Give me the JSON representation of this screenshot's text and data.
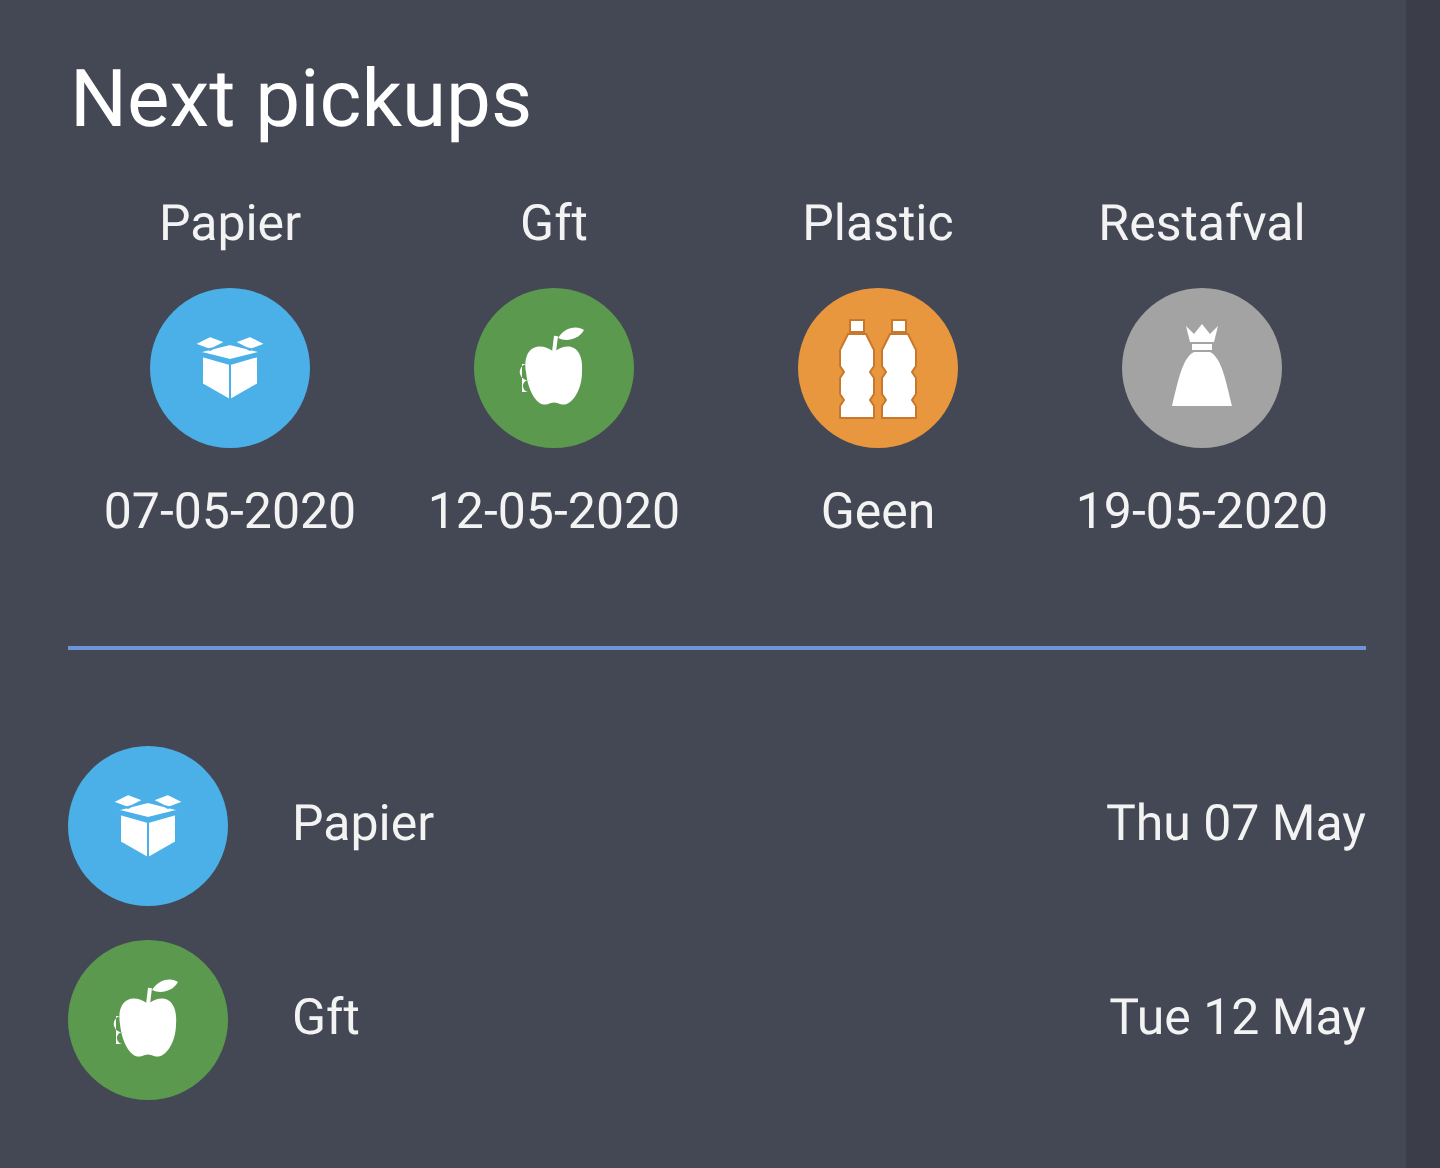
{
  "title": "Next pickups",
  "summary": [
    {
      "kind": "paper",
      "label": "Papier",
      "color": "#4bb0e8",
      "date": "07-05-2020"
    },
    {
      "kind": "organic",
      "label": "Gft",
      "color": "#5b9a4e",
      "date": "12-05-2020"
    },
    {
      "kind": "plastic",
      "label": "Plastic",
      "color": "#e8973e",
      "date": "Geen"
    },
    {
      "kind": "residual",
      "label": "Restafval",
      "color": "#a3a3a3",
      "date": "19-05-2020"
    }
  ],
  "list": [
    {
      "kind": "paper",
      "label": "Papier",
      "color": "#4bb0e8",
      "date": "Thu 07 May"
    },
    {
      "kind": "organic",
      "label": "Gft",
      "color": "#5b9a4e",
      "date": "Tue 12 May"
    }
  ]
}
